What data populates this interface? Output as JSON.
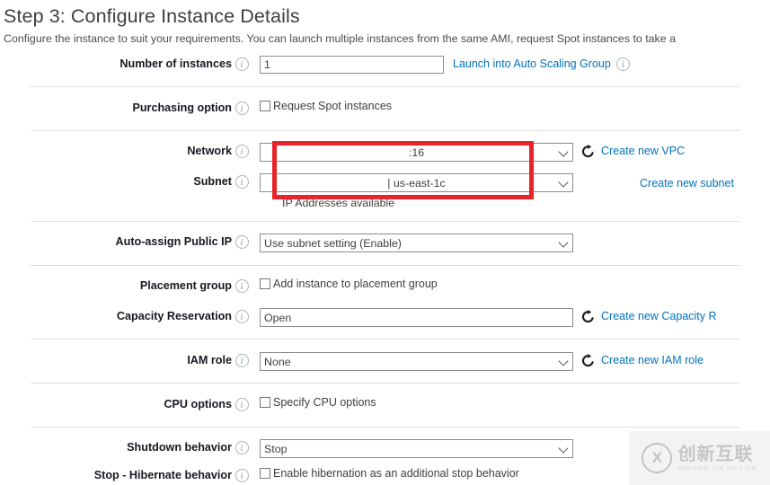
{
  "header": {
    "title": "Step 3: Configure Instance Details",
    "subtitle": "Configure the instance to suit your requirements. You can launch multiple instances from the same AMI, request Spot instances to take a"
  },
  "rows": {
    "number_of_instances": {
      "label": "Number of instances",
      "value": "1",
      "link": "Launch into Auto Scaling Group"
    },
    "purchasing_option": {
      "label": "Purchasing option",
      "checkbox_label": "Request Spot instances",
      "checked": false
    },
    "network": {
      "label": "Network",
      "value": ":16",
      "link": "Create new VPC"
    },
    "subnet": {
      "label": "Subnet",
      "value": "| us-east-1c",
      "link": "Create new subnet",
      "helper": "IP Addresses available"
    },
    "auto_assign_public_ip": {
      "label": "Auto-assign Public IP",
      "value": "Use subnet setting (Enable)"
    },
    "placement_group": {
      "label": "Placement group",
      "checkbox_label": "Add instance to placement group",
      "checked": false
    },
    "capacity_reservation": {
      "label": "Capacity Reservation",
      "value": "Open",
      "link": "Create new Capacity R"
    },
    "iam_role": {
      "label": "IAM role",
      "value": "None",
      "link": "Create new IAM role"
    },
    "cpu_options": {
      "label": "CPU options",
      "checkbox_label": "Specify CPU options",
      "checked": false
    },
    "shutdown_behavior": {
      "label": "Shutdown behavior",
      "value": "Stop"
    },
    "stop_hibernate_behavior": {
      "label": "Stop - Hibernate behavior",
      "checkbox_label": "Enable hibernation as an additional stop behavior",
      "checked": false
    }
  },
  "icons": {
    "info": "i",
    "info_icon_name": "info-icon",
    "refresh_icon_name": "refresh-icon",
    "chevron_icon_name": "chevron-down-icon"
  },
  "annotation": {
    "highlight_color": "#e8232a",
    "highlight_target": "network-and-subnet-fields"
  },
  "watermark": {
    "cn": "创新互联",
    "en": "CHUANG XIN HU LIAN"
  }
}
